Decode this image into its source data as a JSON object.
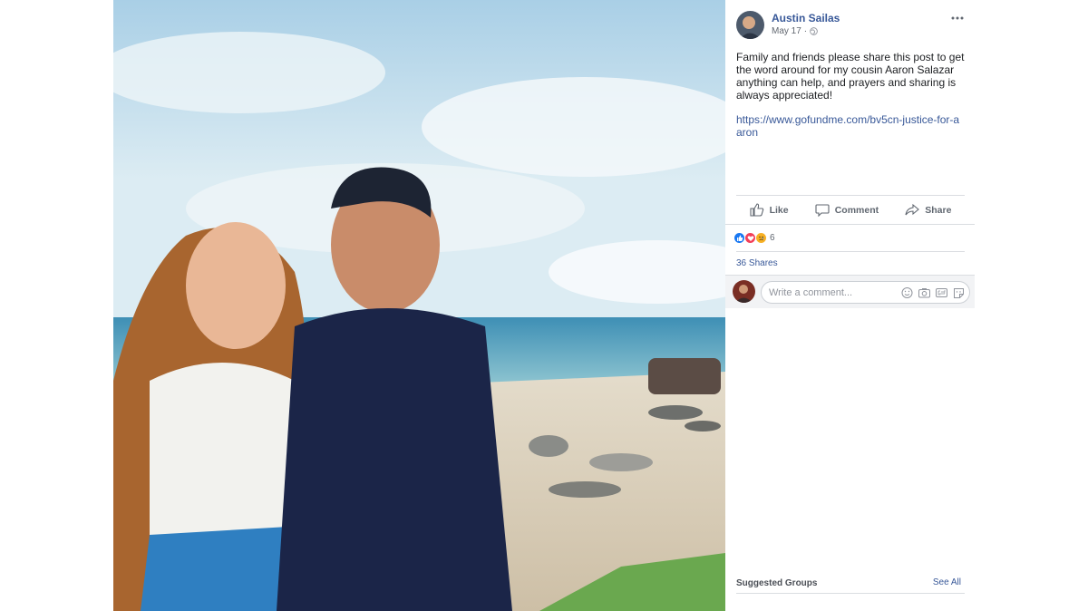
{
  "post": {
    "author": "Austin Sailas",
    "date": "May 17",
    "separator": "·",
    "privacy_icon": "globe-icon",
    "text": "Family and friends please share this post to get the word around for my cousin Aaron Salazar anything can help, and prayers and sharing is always appreciated!",
    "link": "https://www.gofundme.com/bv5cn-justice-for-aaron"
  },
  "actions": {
    "like": "Like",
    "comment": "Comment",
    "share": "Share"
  },
  "reactions": {
    "icons": [
      "like-reaction-icon",
      "love-reaction-icon",
      "sad-reaction-icon"
    ],
    "count": "6"
  },
  "shares": {
    "label": "36 Shares"
  },
  "comment_box": {
    "placeholder": "Write a comment...",
    "icons": [
      "emoji-icon",
      "camera-icon",
      "gif-icon",
      "sticker-icon"
    ]
  },
  "sidebar": {
    "suggested_groups": "Suggested Groups",
    "see_all": "See All"
  },
  "colors": {
    "link": "#385898",
    "border": "#dadde1",
    "muted": "#606770",
    "like_blue": "#1877f2",
    "love_red": "#f33e58",
    "sad_yellow": "#f7b125"
  }
}
